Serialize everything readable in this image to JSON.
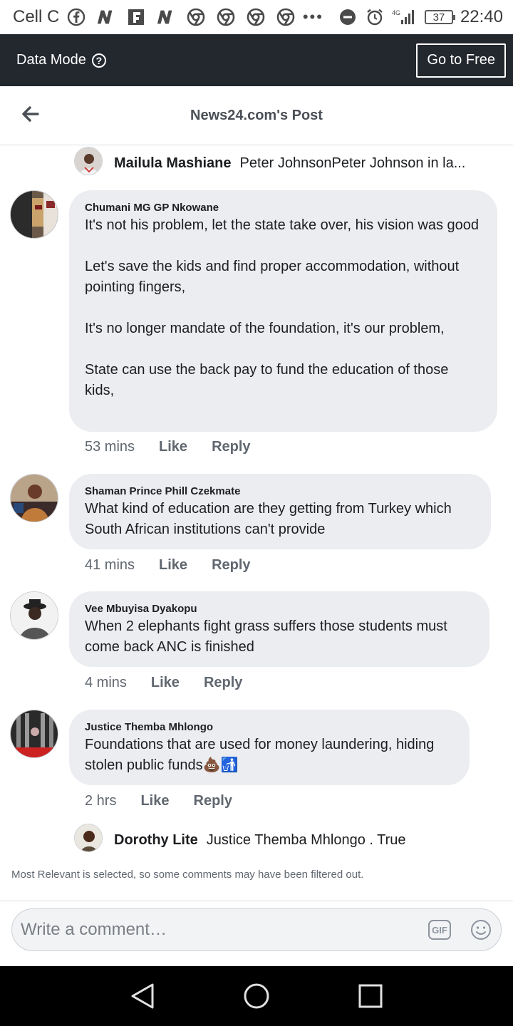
{
  "status_bar": {
    "carrier": "Cell C",
    "network": "4G",
    "battery": "37",
    "time": "22:40",
    "overflow": "•••"
  },
  "data_bar": {
    "title": "Data Mode",
    "go_free_label": "Go to Free"
  },
  "header": {
    "title": "News24.com's Post"
  },
  "comments": [
    {
      "type": "reply",
      "name": "Mailula Mashiane",
      "text": "Peter JohnsonPeter Johnson in la..."
    },
    {
      "type": "comment",
      "name": "Chumani MG GP Nkowane",
      "paragraphs": [
        "It's not his problem, let the state take over, his vision was good",
        "Let's save the kids and find proper accommodation, without pointing fingers,",
        "It's no longer mandate of the foundation, it's our problem,",
        "State can use the back pay to fund the education of those kids,"
      ],
      "time": "53 mins",
      "like": "Like",
      "reply": "Reply"
    },
    {
      "type": "comment",
      "name": "Shaman Prince Phill Czekmate",
      "paragraphs": [
        "What kind of education are they getting from Turkey which South African institutions can't provide"
      ],
      "time": "41 mins",
      "like": "Like",
      "reply": "Reply"
    },
    {
      "type": "comment",
      "name": "Vee Mbuyisa Dyakopu",
      "paragraphs": [
        "When 2 elephants fight grass suffers those students must come back ANC is finished"
      ],
      "time": "4 mins",
      "like": "Like",
      "reply": "Reply"
    },
    {
      "type": "comment",
      "name": "Justice Themba Mhlongo",
      "paragraphs": [
        "Foundations that are used for money laundering, hiding stolen public funds💩🚮"
      ],
      "time": "2 hrs",
      "like": "Like",
      "reply": "Reply"
    },
    {
      "type": "reply",
      "name": "Dorothy Lite",
      "text": "Justice Themba Mhlongo . True"
    }
  ],
  "filter_note": "Most Relevant is selected, so some comments may have been filtered out.",
  "composer": {
    "placeholder": "Write a comment…",
    "gif_label": "GIF"
  }
}
